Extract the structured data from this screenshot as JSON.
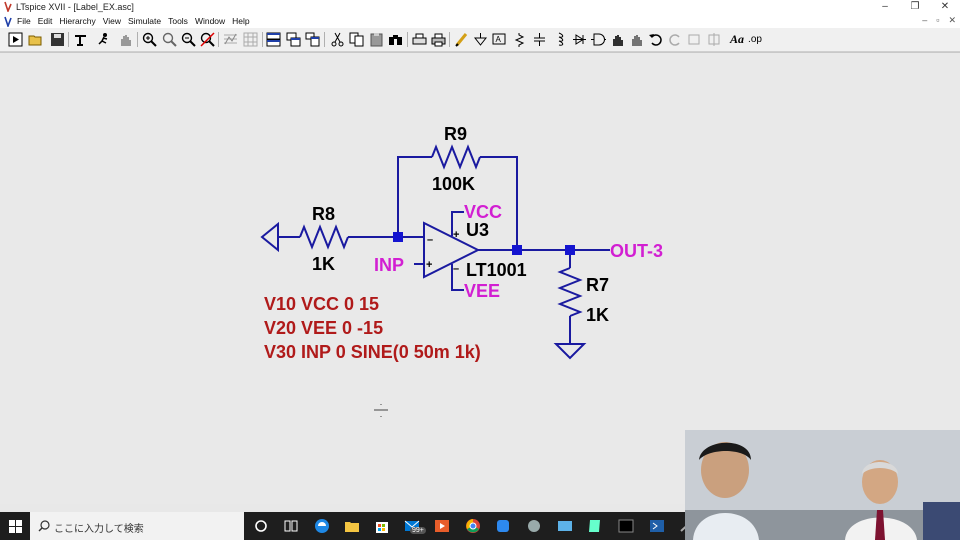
{
  "window": {
    "title": "LTspice XVII - [Label_EX.asc]",
    "controls": [
      "–",
      "❐",
      "✕"
    ]
  },
  "menubar": {
    "items": [
      "File",
      "Edit",
      "Hierarchy",
      "View",
      "Simulate",
      "Tools",
      "Window",
      "Help"
    ],
    "mdi_controls": [
      "–",
      "▫",
      "✕"
    ]
  },
  "toolbar": {
    "icons": [
      "run-icon",
      "open-icon",
      "save-icon",
      "control-panel-icon",
      "run-runner-icon",
      "pan-hand-icon",
      "zoom-in-icon",
      "zoom-area-icon",
      "zoom-out-icon",
      "zoom-cancel-icon",
      "autorange-icon",
      "grid-icon",
      "tile-horizontal-icon",
      "cascade-icon",
      "tile-vertical-icon",
      "cut-icon",
      "copy-icon",
      "paste-icon",
      "delete-icon",
      "find-icon",
      "print-setup-icon",
      "print-icon",
      "draw-wire-icon",
      "ground-icon",
      "label-net-icon",
      "resistor-icon",
      "capacitor-icon",
      "inductor-icon",
      "diode-icon",
      "component-icon",
      "move-hand-icon",
      "drag-icon",
      "undo-icon",
      "redo-icon",
      "rotate-icon",
      "mirror-icon",
      "text-icon",
      "spice-directive-icon"
    ],
    "text_icon_label": "Aa",
    "spice_directive_label": ".op"
  },
  "schematic": {
    "colors": {
      "wire": "#1a1aa0",
      "node": "#1414d0",
      "label": "#d21fd2",
      "directive": "#b01a1a",
      "text": "#000000"
    },
    "components": {
      "r9": {
        "name": "R9",
        "value": "100K"
      },
      "r8": {
        "name": "R8",
        "value": "1K"
      },
      "r7": {
        "name": "R7",
        "value": "1K"
      },
      "u3": {
        "name": "U3",
        "value": "LT1001",
        "minus": "–",
        "plus": "+"
      }
    },
    "net_labels": {
      "vcc": "VCC",
      "vee": "VEE",
      "inp": "INP",
      "out": "OUT-3"
    },
    "directives": [
      "V10 VCC 0 15",
      "V20 VEE 0 -15",
      "V30 INP 0 SINE(0 50m 1k)"
    ]
  },
  "taskbar": {
    "search_placeholder": "ここに入力して検索",
    "mail_badge": "99+"
  }
}
